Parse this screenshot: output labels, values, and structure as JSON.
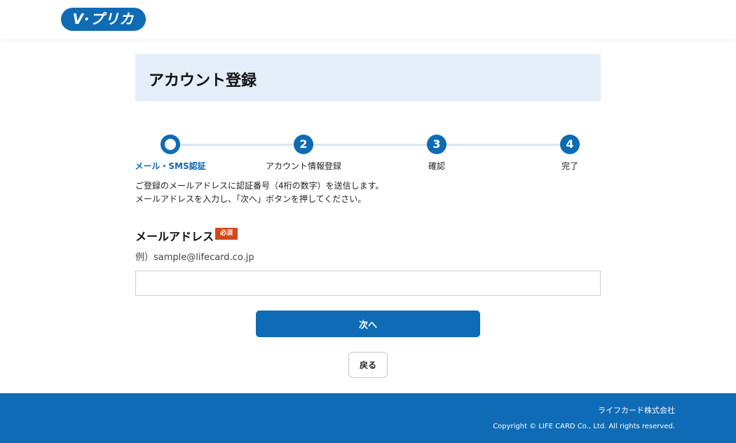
{
  "header": {
    "logo_text": "V·プリカ"
  },
  "page_title": "アカウント登録",
  "stepper": {
    "steps": [
      {
        "number": "",
        "label": "メール・SMS認証",
        "state": "current"
      },
      {
        "number": "2",
        "label": "アカウント情報登録",
        "state": "pending"
      },
      {
        "number": "3",
        "label": "確認",
        "state": "pending"
      },
      {
        "number": "4",
        "label": "完了",
        "state": "pending"
      }
    ]
  },
  "description": {
    "line1": "ご登録のメールアドレスに認証番号（4桁の数字）を送信します。",
    "line2": "メールアドレスを入力し、「次へ」ボタンを押してください。"
  },
  "form": {
    "email_label": "メールアドレス",
    "required_badge": "必須",
    "email_example": "例）sample@lifecard.co.jp",
    "email_value": "",
    "email_placeholder": ""
  },
  "buttons": {
    "next": "次へ",
    "back": "戻る"
  },
  "footer": {
    "company": "ライフカード株式会社",
    "copyright": "Copyright © LIFE CARD Co., Ltd. All rights reserved."
  },
  "colors": {
    "brand_blue": "#0f6bb5",
    "title_bg": "#e4eef8",
    "required_badge": "#d3491b"
  }
}
